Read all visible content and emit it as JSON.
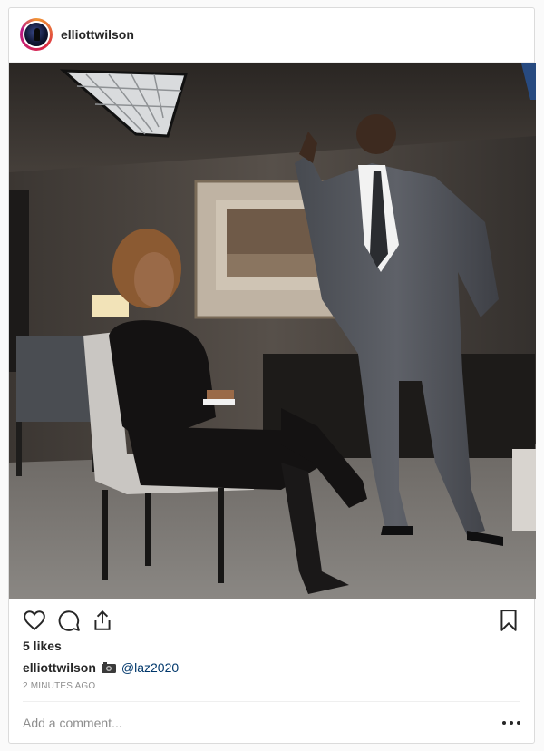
{
  "post": {
    "username": "elliottwilson",
    "likes": "5 likes",
    "caption": {
      "username": "elliottwilson",
      "emoji_icon": "camera-icon",
      "mention": "@laz2020"
    },
    "timestamp": "2 MINUTES AGO",
    "comment_placeholder": "Add a comment...",
    "icons": [
      "like-heart-icon",
      "comment-bubble-icon",
      "share-icon",
      "bookmark-icon",
      "more-options-icon"
    ]
  },
  "colors": {
    "text": "#262626",
    "muted": "#8e8e8e",
    "mention": "#00376b",
    "border": "#dbdbdb"
  }
}
